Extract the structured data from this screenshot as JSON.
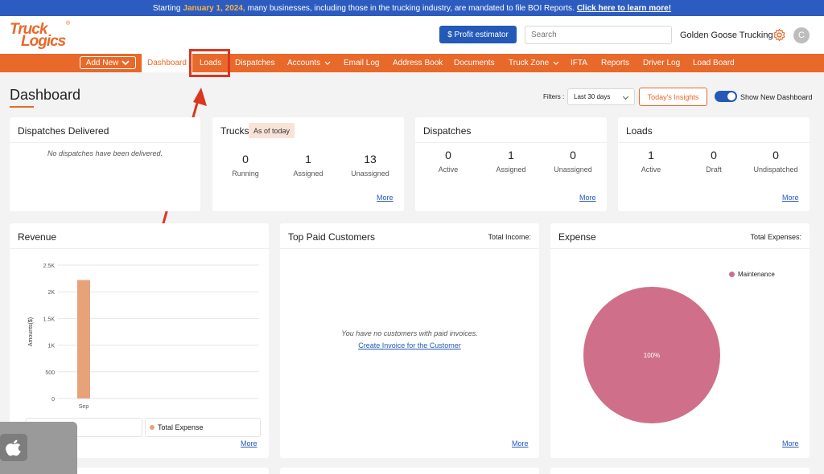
{
  "banner": {
    "prefix": "Starting",
    "date": "January 1, 2024,",
    "text": "many businesses, including those in the trucking industry, are mandated to file BOI Reports.",
    "link": "Click here to learn more!"
  },
  "header": {
    "logo_line1": "Truck",
    "logo_line2": "Logics",
    "logo_reg": "®",
    "profit_label": "$ Profit estimator",
    "search_placeholder": "Search",
    "company": "Golden Goose Trucking",
    "avatar_initial": "C"
  },
  "nav": {
    "add_new": "Add New",
    "items": [
      "Dashboard",
      "Loads",
      "Dispatches",
      "Accounts",
      "Email Log",
      "Address Book",
      "Documents",
      "Truck Zone",
      "IFTA",
      "Reports",
      "Driver Log",
      "Load Board"
    ],
    "active": "Dashboard",
    "highlighted": "Loads"
  },
  "page": {
    "title": "Dashboard",
    "filters_label": "Filters :",
    "filter_value": "Last 30 days",
    "insights": "Today's Insights",
    "toggle_label": "Show New Dashboard",
    "toggle_on": true
  },
  "cards": {
    "dispatches_delivered": {
      "title": "Dispatches Delivered",
      "message": "No dispatches have been delivered."
    },
    "trucks": {
      "title": "Trucks",
      "badge": "As of today",
      "stats": [
        {
          "value": "0",
          "label": "Running"
        },
        {
          "value": "1",
          "label": "Assigned"
        },
        {
          "value": "13",
          "label": "Unassigned"
        }
      ],
      "more": "More"
    },
    "dispatches": {
      "title": "Dispatches",
      "stats": [
        {
          "value": "0",
          "label": "Active"
        },
        {
          "value": "1",
          "label": "Assigned"
        },
        {
          "value": "0",
          "label": "Unassigned"
        }
      ],
      "more": "More"
    },
    "loads": {
      "title": "Loads",
      "stats": [
        {
          "value": "1",
          "label": "Active"
        },
        {
          "value": "0",
          "label": "Draft"
        },
        {
          "value": "0",
          "label": "Undispatched"
        }
      ],
      "more": "More"
    },
    "revenue": {
      "title": "Revenue",
      "legend": "Total Expense",
      "more": "More"
    },
    "top_paid": {
      "title": "Top Paid Customers",
      "right": "Total Income:",
      "message": "You have no customers with paid invoices.",
      "link": "Create Invoice for the Customer",
      "more": "More"
    },
    "expense": {
      "title": "Expense",
      "right": "Total Expenses:",
      "legend": "Maintenance",
      "more": "More"
    }
  },
  "colors": {
    "brand": "#e8692a",
    "blue": "#2459b8",
    "bar": "#e8a27a",
    "pie": "#cf6f8a"
  },
  "chart_data": [
    {
      "type": "bar",
      "categories": [
        "Sep"
      ],
      "values": [
        2220
      ],
      "ylabel": "Amounts($)",
      "yticks": [
        "0",
        "500",
        "1K",
        "1.5K",
        "2K",
        "2.5K"
      ],
      "ylim": [
        0,
        2500
      ],
      "legend": "Total Expense",
      "grid": true
    },
    {
      "type": "pie",
      "categories": [
        "Maintenance"
      ],
      "values": [
        100
      ],
      "labels": [
        "100%"
      ],
      "legend_position": "top-right"
    }
  ]
}
